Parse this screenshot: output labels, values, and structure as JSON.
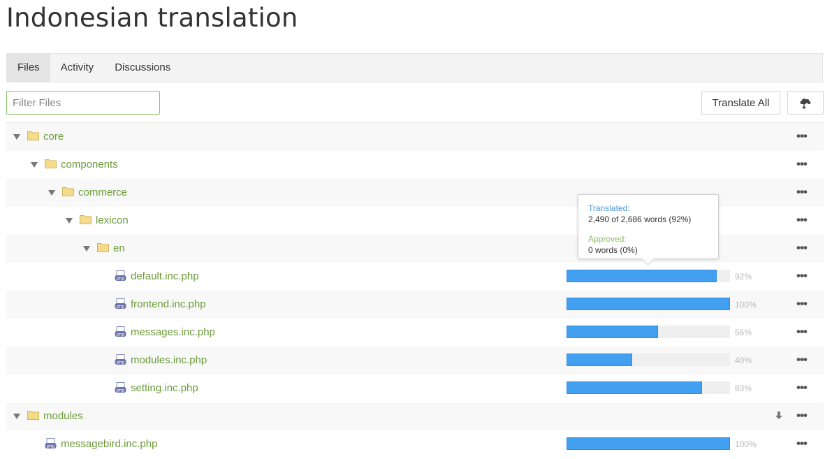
{
  "page": {
    "title": "Indonesian translation"
  },
  "tabs": [
    {
      "label": "Files",
      "active": true
    },
    {
      "label": "Activity",
      "active": false
    },
    {
      "label": "Discussions",
      "active": false
    }
  ],
  "toolbar": {
    "filter_placeholder": "Filter Files",
    "translate_all_label": "Translate All",
    "cloud_icon": "cloud-sync-icon"
  },
  "colors": {
    "link_green": "#6c9b3a",
    "bar_blue": "#439ff0",
    "accent_green": "#8cc063"
  },
  "tree": {
    "core": "core",
    "components": "components",
    "commerce": "commerce",
    "lexicon": "lexicon",
    "en": "en",
    "files": [
      {
        "name": "default.inc.php",
        "percent": 92,
        "percent_label": "92%"
      },
      {
        "name": "frontend.inc.php",
        "percent": 100,
        "percent_label": "100%"
      },
      {
        "name": "messages.inc.php",
        "percent": 56,
        "percent_label": "56%"
      },
      {
        "name": "modules.inc.php",
        "percent": 40,
        "percent_label": "40%"
      },
      {
        "name": "setting.inc.php",
        "percent": 83,
        "percent_label": "83%"
      }
    ],
    "modules": "modules",
    "module_file": {
      "name": "messagebird.inc.php",
      "percent": 100,
      "percent_label": "100%"
    }
  },
  "more_glyph": "•••",
  "tooltip": {
    "translated_label": "Translated:",
    "translated_value": "2,490 of 2,686 words (92%)",
    "approved_label": "Approved:",
    "approved_value": "0 words (0%)"
  }
}
